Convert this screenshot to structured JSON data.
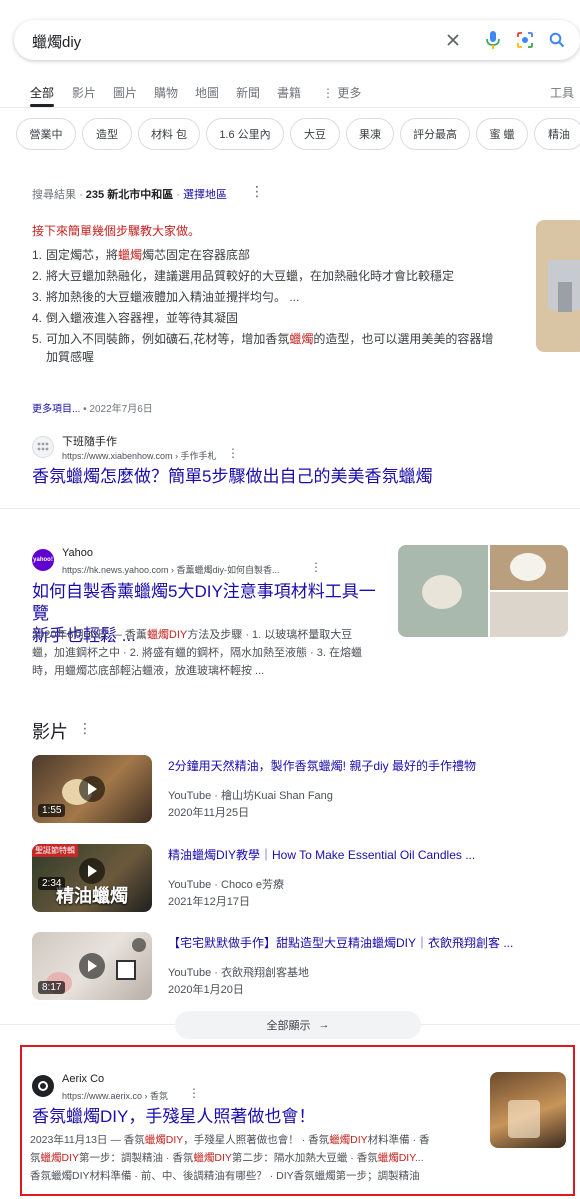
{
  "search": {
    "query": "蠟燭diy"
  },
  "tabs": [
    {
      "label": "全部"
    },
    {
      "label": "影片"
    },
    {
      "label": "圖片"
    },
    {
      "label": "購物"
    },
    {
      "label": "地圖"
    },
    {
      "label": "新聞"
    },
    {
      "label": "書籍"
    },
    {
      "label": "更多"
    }
  ],
  "tools_label": "工具",
  "chips": [
    "營業中",
    "造型",
    "材料 包",
    "1.6 公里內",
    "大豆",
    "果凍",
    "評分最高",
    "蜜 蠟",
    "精油"
  ],
  "location": {
    "prefix": "搜尋結果",
    "place": "235 新北市中和區",
    "choose": "選擇地區"
  },
  "featured": {
    "heading": "接下來簡單幾個步驟教大家做。",
    "steps": [
      {
        "n": "1.",
        "parts": [
          "固定燭芯，將",
          "蠟燭",
          "燭芯固定在容器底部"
        ]
      },
      {
        "n": "2.",
        "parts": [
          "將大豆蠟加熱融化，建議選用品質較好的大豆蠟，在加熱融化時才會比較穩定",
          "",
          ""
        ]
      },
      {
        "n": "3.",
        "parts": [
          "將加熱後的大豆蠟液體加入精油並攪拌均勻。 ...",
          "",
          ""
        ]
      },
      {
        "n": "4.",
        "parts": [
          "倒入蠟液進入容器裡，並等待其凝固",
          "",
          ""
        ]
      },
      {
        "n": "5.",
        "parts": [
          "可加入不同裝飾，例如礦石,花材等，增加香氛",
          "蠟燭",
          "的造型，也可以選用美美的容器增加質感喔"
        ]
      }
    ],
    "more": "更多項目...",
    "date": "• 2022年7月6日",
    "source_name": "下班隨手作",
    "source_url": "https://www.xiabenhow.com › 手作手札",
    "title": "香氛蠟燭怎麼做？簡單5步驟做出自己的美美香氛蠟燭"
  },
  "yahoo": {
    "favicon_text": "yahoo!",
    "source_name": "Yahoo",
    "source_url": "https://hk.news.yahoo.com › 香薰蠟燭diy-如何自製香...",
    "title_line1": "如何自製香薰蠟燭5大DIY注意事項材料工具一覽",
    "title_line2": "新手也輕鬆 ...",
    "snippet_line1a": "2020年8月30日 — 香薰",
    "snippet_line1b": "蠟燭DIY",
    "snippet_line1c": "方法及步驟 · 1. 以玻璃杯量取大豆",
    "snippet_line2": "蠟，加進鋼杯之中 · 2. 將盛有蠟的鋼杯，隔水加熱至液態 · 3. 在熔蠟",
    "snippet_line3": "時，用蠟燭芯底部輕沾蠟液，放進玻璃杯輕按 ..."
  },
  "videos": {
    "heading": "影片",
    "items": [
      {
        "title": "2分鐘用天然精油，製作香氛蠟燭! 親子diy 最好的手作禮物",
        "platform": "YouTube · 檜山坊Kuai Shan Fang",
        "date": "2020年11月25日",
        "duration": "1:55"
      },
      {
        "title": "精油蠟燭DIY教學｜How To Make Essential Oil Candles ...",
        "platform": "YouTube · Choco e芳療",
        "date": "2021年12月17日",
        "duration": "2:34",
        "thumb_text": "精油蠟燭",
        "badge": "聖誕節特輯"
      },
      {
        "title": "【宅宅默默做手作】甜點造型大豆精油蠟燭DIY｜衣飲飛翔創客 ...",
        "platform": "YouTube · 衣飲飛翔創客基地",
        "date": "2020年1月20日",
        "duration": "8:17"
      }
    ],
    "show_all": "全部顯示"
  },
  "aerix": {
    "source_name": "Aerix Co",
    "source_url": "https://www.aerix.co › 香氛",
    "title": "香氛蠟燭DIY，手殘星人照著做也會！",
    "line1": [
      {
        "t": "2023年11月13日 — 香氛",
        "h": false
      },
      {
        "t": "蠟燭DIY",
        "h": true
      },
      {
        "t": "，手殘星人照著做也會！ · 香氛",
        "h": false
      },
      {
        "t": "蠟燭DIY",
        "h": true
      },
      {
        "t": "材料準備 · 香",
        "h": false
      }
    ],
    "line2": [
      {
        "t": "氛",
        "h": false
      },
      {
        "t": "蠟燭DIY",
        "h": true
      },
      {
        "t": "第一步：調製精油 · 香氛",
        "h": false
      },
      {
        "t": "蠟燭DIY",
        "h": true
      },
      {
        "t": "第二步：隔水加熱大豆蠟 · 香氛",
        "h": false
      },
      {
        "t": "蠟燭DIY",
        "h": true
      },
      {
        "t": "...",
        "h": false
      }
    ],
    "line3": "香氛蠟燭DIY材料準備 · 前、中、後調精油有哪些？ · DIY香氛蠟燭第一步；調製精油"
  },
  "colors": {
    "link": "#1a0dab",
    "highlight": "#c5221f",
    "red_frame": "#e0191f"
  }
}
